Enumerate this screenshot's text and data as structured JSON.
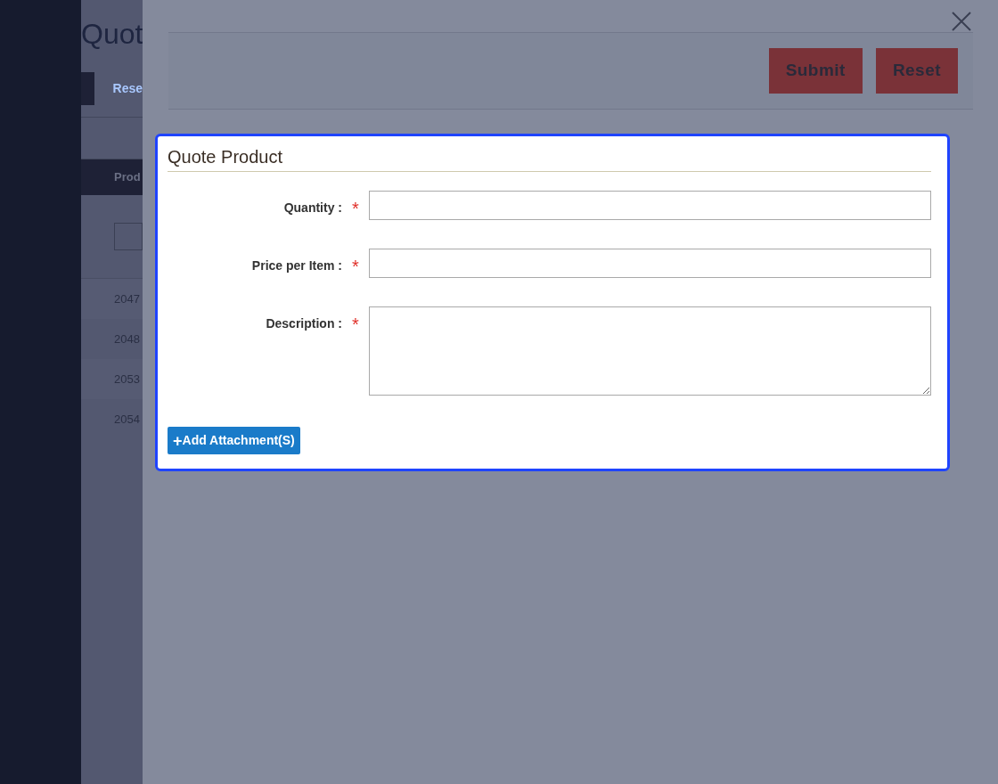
{
  "background_page": {
    "title": "Quot",
    "link": "Rese",
    "table": {
      "column_1": "Prod",
      "rows": [
        "2047",
        "2048",
        "2053",
        "2054"
      ]
    }
  },
  "panel": {
    "toolbar": {
      "buttons": [
        "Submit",
        "Reset"
      ]
    }
  },
  "modal": {
    "title": "Quote Product",
    "fields": [
      {
        "label": "Quantity :",
        "required_mark": "*",
        "kind": "input"
      },
      {
        "label": "Price per Item :",
        "required_mark": "*",
        "kind": "input"
      },
      {
        "label": "Description :",
        "required_mark": "*",
        "kind": "textarea"
      }
    ],
    "attach_button": {
      "icon": "+",
      "label": "Add Attachment(S)"
    }
  }
}
